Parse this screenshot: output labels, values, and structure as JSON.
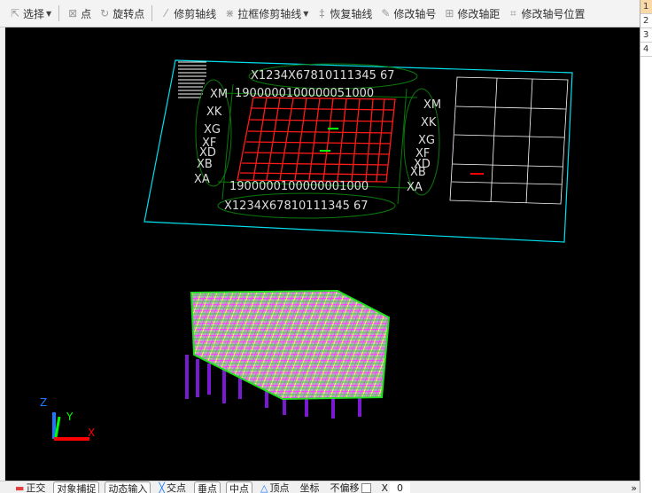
{
  "toolbar": {
    "items": [
      {
        "label": "选择",
        "icon": "cursor-icon"
      },
      {
        "label": "点",
        "icon": "point-icon"
      },
      {
        "label": "旋转点",
        "icon": "rotate-point-icon"
      },
      {
        "label": "修剪轴线",
        "icon": "trim-axis-icon"
      },
      {
        "label": "拉框修剪轴线",
        "icon": "box-trim-icon"
      },
      {
        "label": "恢复轴线",
        "icon": "restore-axis-icon"
      },
      {
        "label": "修改轴号",
        "icon": "edit-axis-number-icon"
      },
      {
        "label": "修改轴距",
        "icon": "edit-axis-spacing-icon"
      },
      {
        "label": "修改轴号位置",
        "icon": "edit-axis-position-icon"
      }
    ]
  },
  "right_panel": {
    "rows": [
      "1",
      "2",
      "3",
      "4"
    ]
  },
  "drawing": {
    "top_axes": "X1234X67810111345 67",
    "bottom_axes": "X1234X67810111345 67",
    "dims_top": "1900000100000051000",
    "dims_bottom": "1900000100000001000",
    "left_axes": [
      "XM",
      "XK",
      "XG",
      "XF",
      "XD",
      "XB",
      "XA"
    ],
    "right_axes": [
      "XM",
      "XK",
      "XG",
      "XF",
      "XD",
      "XB",
      "XA"
    ],
    "ucs": {
      "x": "X",
      "y": "Y",
      "z": "Z"
    }
  },
  "statusbar": {
    "items": [
      "正交",
      "对象捕捉",
      "动态输入",
      "交点",
      "垂点",
      "中点",
      "顶点",
      "坐标",
      "不偏移",
      "X",
      "0"
    ],
    "more": "»"
  }
}
